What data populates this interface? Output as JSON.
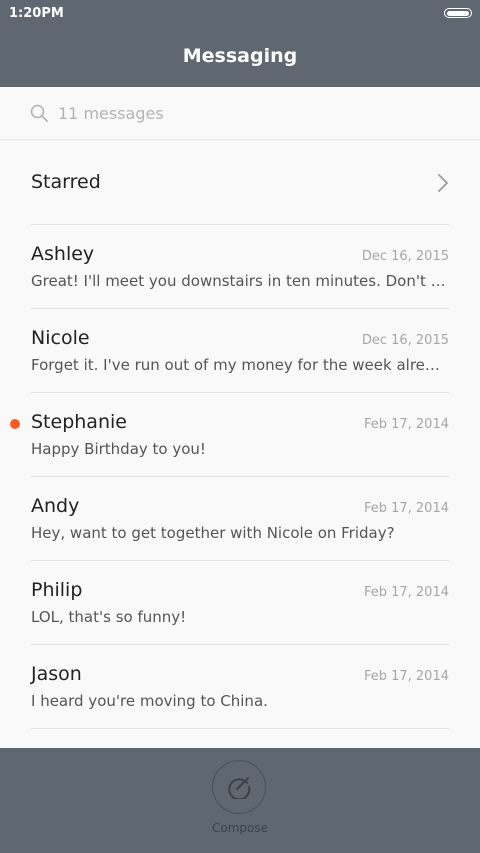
{
  "status_bar": {
    "time": "1:20PM"
  },
  "header": {
    "title": "Messaging"
  },
  "search": {
    "placeholder": "11 messages"
  },
  "starred": {
    "label": "Starred"
  },
  "conversations": [
    {
      "name": "Ashley",
      "date": "Dec 16, 2015",
      "preview": "Great! I'll meet you downstairs in ten minutes. Don't forget...",
      "unread": false
    },
    {
      "name": "Nicole",
      "date": "Dec 16, 2015",
      "preview": "Forget it. I've run out of my money for the week already.",
      "unread": false
    },
    {
      "name": "Stephanie",
      "date": "Feb 17, 2014",
      "preview": "Happy Birthday to you!",
      "unread": true
    },
    {
      "name": "Andy",
      "date": "Feb 17, 2014",
      "preview": "Hey, want to get together with Nicole on Friday?",
      "unread": false
    },
    {
      "name": "Philip",
      "date": "Feb 17, 2014",
      "preview": "LOL, that's so funny!",
      "unread": false
    },
    {
      "name": "Jason",
      "date": "Feb 17, 2014",
      "preview": "I heard you're moving to China.",
      "unread": false
    }
  ],
  "footer": {
    "compose_label": "Compose"
  },
  "colors": {
    "header_bg": "#5f6870",
    "unread_dot": "#ff5a1f",
    "footer_bg": "#5f6870"
  },
  "icons": [
    "search-icon",
    "chevron-right-icon",
    "compose-icon",
    "battery-icon"
  ]
}
